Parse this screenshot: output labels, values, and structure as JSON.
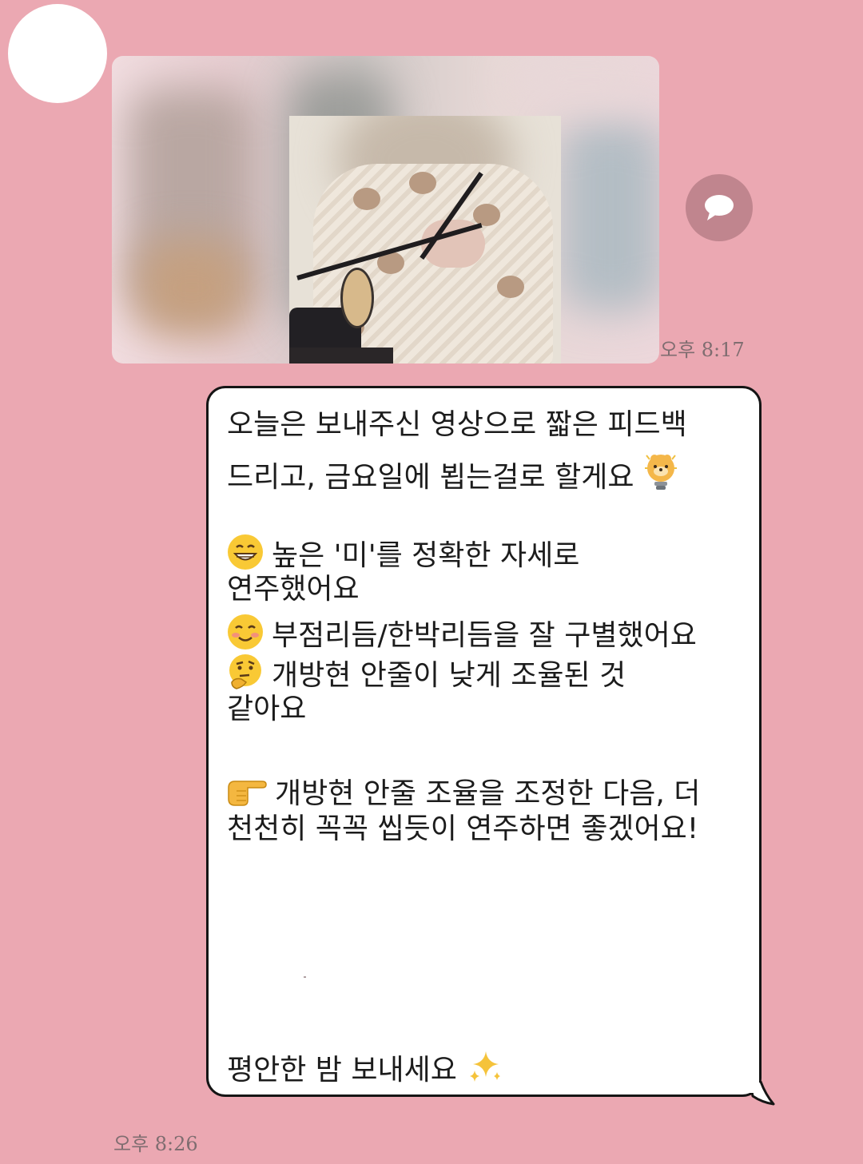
{
  "chat": {
    "photo_time": "오후 8:17",
    "message_time": "오후 8:26",
    "lines": [
      "오늘은 보내주신 영상으로 짧은 피드백",
      "드리고, 금요일에 뵙는걸로 할게요",
      "높은 '미'를 정확한 자세로",
      "연주했어요",
      "부점리듬/한박리듬을 잘 구별했어요",
      "개방현 안줄이 낮게 조율된 것",
      "같아요",
      "개방현 안줄 조율을 조정한 다음, 더",
      "천천히 꼭꼭 씹듯이 연주하면 좋겠어요!",
      "평안한 밤 보내세요"
    ]
  },
  "icons": {
    "share": "speech-bubble-icon",
    "line2": "lightbulb-character-icon",
    "line3": "grinning-face-icon",
    "line5": "smiling-face-icon",
    "line6": "thinking-face-icon",
    "line8": "pointing-hand-icon",
    "line10": "sparkles-icon"
  },
  "colors": {
    "background": "#eba8b2",
    "bubble": "#ffffff",
    "bubble_border": "#151515",
    "share_button": "#c0858e",
    "timestamp": "#7f6d70"
  }
}
